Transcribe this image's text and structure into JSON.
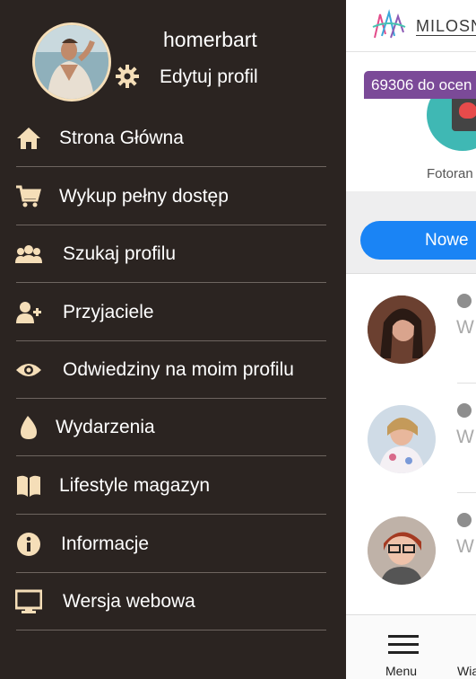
{
  "main": {
    "brand": "MILOSN",
    "badge_count": "69306 do ocen",
    "promo_label": "Fotoran",
    "new_button": "Nowe",
    "list_rows": [
      {
        "preview": "W"
      },
      {
        "preview": "W"
      },
      {
        "preview": "W"
      }
    ],
    "bottom_nav": {
      "menu_label": "Menu",
      "second_label": "Wia"
    }
  },
  "drawer": {
    "username": "homerbart",
    "edit_profile_label": "Edytuj profil",
    "items": [
      {
        "label": "Strona Główna",
        "icon": "home-icon"
      },
      {
        "label": "Wykup pełny dostęp",
        "icon": "cart-icon"
      },
      {
        "label": "Szukaj profilu",
        "icon": "people-icon"
      },
      {
        "label": "Przyjaciele",
        "icon": "add-user-icon"
      },
      {
        "label": "Odwiedziny na moim profilu",
        "icon": "eye-icon"
      },
      {
        "label": "Wydarzenia",
        "icon": "drop-icon"
      },
      {
        "label": "Lifestyle magazyn",
        "icon": "book-icon"
      },
      {
        "label": "Informacje",
        "icon": "info-icon"
      },
      {
        "label": "Wersja webowa",
        "icon": "monitor-icon"
      }
    ]
  },
  "colors": {
    "drawer_bg": "#2b2421",
    "icon_color": "#f5deb8",
    "badge_bg": "#7b4a98",
    "button_blue": "#1a84f5",
    "avatar_border": "#f5deb8"
  }
}
